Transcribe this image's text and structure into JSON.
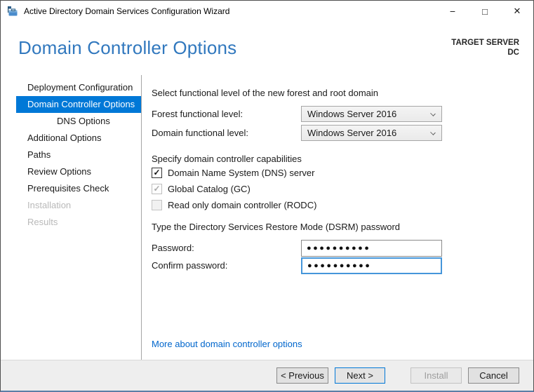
{
  "window": {
    "title": "Active Directory Domain Services Configuration Wizard",
    "controls": {
      "minimize": "−",
      "maximize": "□",
      "close": "✕"
    }
  },
  "header": {
    "title": "Domain Controller Options",
    "target_server_label": "TARGET SERVER",
    "target_server_name": "DC"
  },
  "sidebar": {
    "items": [
      {
        "label": "Deployment Configuration",
        "state": "normal"
      },
      {
        "label": "Domain Controller Options",
        "state": "selected"
      },
      {
        "label": "DNS Options",
        "state": "normal-indented"
      },
      {
        "label": "Additional Options",
        "state": "normal"
      },
      {
        "label": "Paths",
        "state": "normal"
      },
      {
        "label": "Review Options",
        "state": "normal"
      },
      {
        "label": "Prerequisites Check",
        "state": "normal"
      },
      {
        "label": "Installation",
        "state": "disabled"
      },
      {
        "label": "Results",
        "state": "disabled"
      }
    ]
  },
  "main": {
    "functional_levels": {
      "heading": "Select functional level of the new forest and root domain",
      "forest_label": "Forest functional level:",
      "forest_value": "Windows Server 2016",
      "domain_label": "Domain functional level:",
      "domain_value": "Windows Server 2016"
    },
    "capabilities": {
      "heading": "Specify domain controller capabilities",
      "checkboxes": [
        {
          "label": "Domain Name System (DNS) server",
          "checked": true,
          "enabled": true
        },
        {
          "label": "Global Catalog (GC)",
          "checked": true,
          "enabled": false
        },
        {
          "label": "Read only domain controller (RODC)",
          "checked": false,
          "enabled": false
        }
      ]
    },
    "dsrm": {
      "heading": "Type the Directory Services Restore Mode (DSRM) password",
      "password_label": "Password:",
      "password_value": "●●●●●●●●●●",
      "confirm_label": "Confirm password:",
      "confirm_value": "●●●●●●●●●●"
    },
    "help_link": "More about domain controller options"
  },
  "footer": {
    "buttons": [
      {
        "label": "< Previous",
        "state": "normal"
      },
      {
        "label": "Next >",
        "state": "default"
      },
      {
        "label": "Install",
        "state": "disabled"
      },
      {
        "label": "Cancel",
        "state": "normal"
      }
    ]
  },
  "icons": {
    "checkmark": "✓"
  },
  "colors": {
    "accent_blue": "#0078d7",
    "title_blue": "#3178be",
    "link_blue": "#0066cc",
    "selected_nav_bg": "#0078d7",
    "footer_bg": "#eeeeee"
  }
}
